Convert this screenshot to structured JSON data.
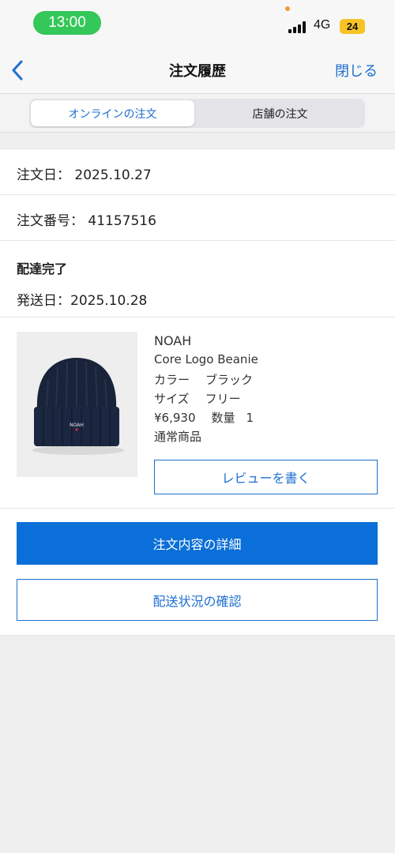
{
  "status_bar": {
    "time": "13:00",
    "network": "4G",
    "battery": "24"
  },
  "nav": {
    "title": "注文履歴",
    "close_label": "閉じる"
  },
  "segments": {
    "online": "オンラインの注文",
    "store": "店舗の注文"
  },
  "order": {
    "date_label": "注文日：",
    "date_value": "2025.10.27",
    "number_label": "注文番号：",
    "number_value": "41157516",
    "status": "配達完了",
    "ship_label": "発送日：",
    "ship_value": "2025.10.28"
  },
  "product": {
    "brand": "NOAH",
    "name": "Core Logo Beanie",
    "color_label": "カラー",
    "color_value": "ブラック",
    "size_label": "サイズ",
    "size_value": "フリー",
    "price": "¥6,930",
    "qty_label": "数量",
    "qty_value": "1",
    "category": "通常商品",
    "logo_text": "NOAH",
    "review_label": "レビューを書く"
  },
  "actions": {
    "detail_label": "注文内容の詳細",
    "delivery_label": "配送状況の確認"
  },
  "colors": {
    "accent": "#1d6fd0",
    "primary_button": "#0a6fd8",
    "status_time_pill": "#34c759",
    "battery": "#f7c325"
  },
  "icons": {
    "back": "chevron-left-icon",
    "signal": "cellular-signal-icon"
  }
}
